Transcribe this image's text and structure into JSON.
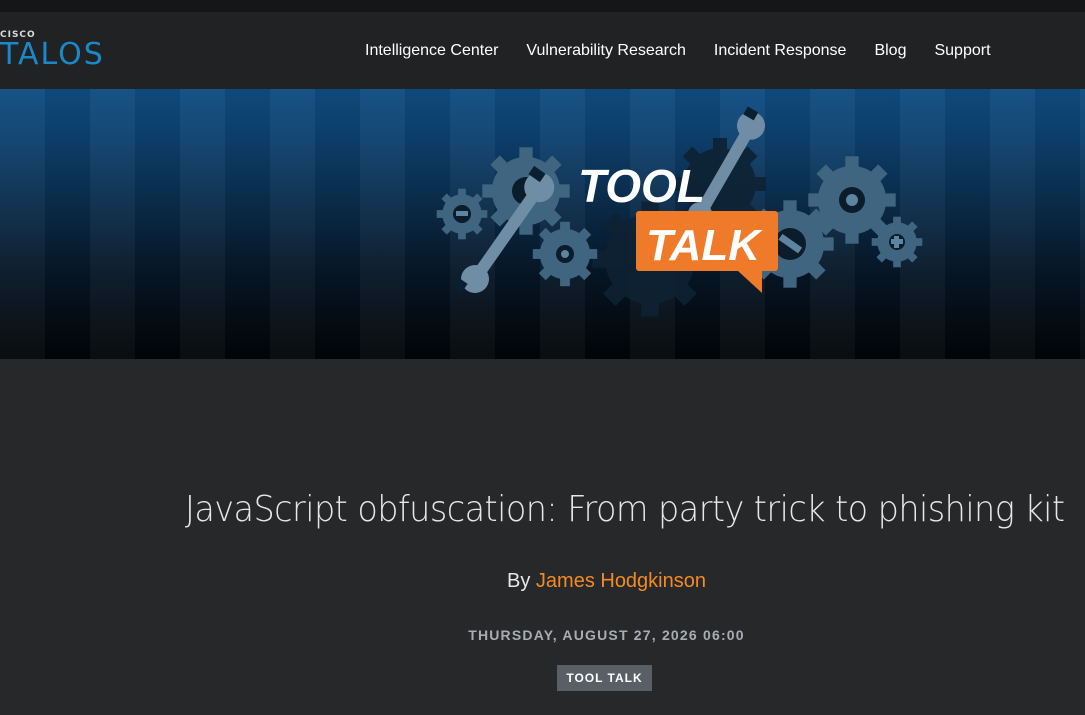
{
  "logo": {
    "brand_small": "CISCO",
    "brand_large": "TALOS"
  },
  "nav": {
    "items": [
      {
        "label": "Intelligence Center"
      },
      {
        "label": "Vulnerability Research"
      },
      {
        "label": "Incident Response"
      },
      {
        "label": "Blog"
      },
      {
        "label": "Support"
      }
    ]
  },
  "hero": {
    "line1": "TOOL",
    "line2": "TALK",
    "colors": {
      "badge": "#ef7a2a",
      "gear": "#4a6f88",
      "wrench": "#6a8aa3"
    }
  },
  "article": {
    "title": "JavaScript obfuscation: From party trick to phishing kit",
    "by_prefix": "By",
    "author": "James Hodgkinson",
    "date": "THURSDAY, AUGUST 27, 2026 06:00",
    "tag": "TOOL TALK"
  },
  "colors": {
    "accent": "#f38b25",
    "logo": "#1b88c9",
    "background": "#27282a"
  }
}
